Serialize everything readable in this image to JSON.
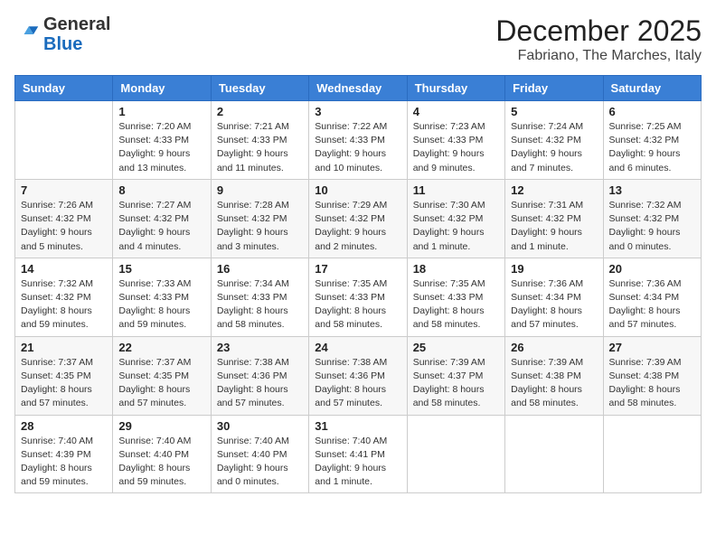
{
  "header": {
    "logo_general": "General",
    "logo_blue": "Blue",
    "month": "December 2025",
    "location": "Fabriano, The Marches, Italy"
  },
  "days_of_week": [
    "Sunday",
    "Monday",
    "Tuesday",
    "Wednesday",
    "Thursday",
    "Friday",
    "Saturday"
  ],
  "weeks": [
    [
      {
        "day": "",
        "sunrise": "",
        "sunset": "",
        "daylight": ""
      },
      {
        "day": "1",
        "sunrise": "Sunrise: 7:20 AM",
        "sunset": "Sunset: 4:33 PM",
        "daylight": "Daylight: 9 hours and 13 minutes."
      },
      {
        "day": "2",
        "sunrise": "Sunrise: 7:21 AM",
        "sunset": "Sunset: 4:33 PM",
        "daylight": "Daylight: 9 hours and 11 minutes."
      },
      {
        "day": "3",
        "sunrise": "Sunrise: 7:22 AM",
        "sunset": "Sunset: 4:33 PM",
        "daylight": "Daylight: 9 hours and 10 minutes."
      },
      {
        "day": "4",
        "sunrise": "Sunrise: 7:23 AM",
        "sunset": "Sunset: 4:33 PM",
        "daylight": "Daylight: 9 hours and 9 minutes."
      },
      {
        "day": "5",
        "sunrise": "Sunrise: 7:24 AM",
        "sunset": "Sunset: 4:32 PM",
        "daylight": "Daylight: 9 hours and 7 minutes."
      },
      {
        "day": "6",
        "sunrise": "Sunrise: 7:25 AM",
        "sunset": "Sunset: 4:32 PM",
        "daylight": "Daylight: 9 hours and 6 minutes."
      }
    ],
    [
      {
        "day": "7",
        "sunrise": "Sunrise: 7:26 AM",
        "sunset": "Sunset: 4:32 PM",
        "daylight": "Daylight: 9 hours and 5 minutes."
      },
      {
        "day": "8",
        "sunrise": "Sunrise: 7:27 AM",
        "sunset": "Sunset: 4:32 PM",
        "daylight": "Daylight: 9 hours and 4 minutes."
      },
      {
        "day": "9",
        "sunrise": "Sunrise: 7:28 AM",
        "sunset": "Sunset: 4:32 PM",
        "daylight": "Daylight: 9 hours and 3 minutes."
      },
      {
        "day": "10",
        "sunrise": "Sunrise: 7:29 AM",
        "sunset": "Sunset: 4:32 PM",
        "daylight": "Daylight: 9 hours and 2 minutes."
      },
      {
        "day": "11",
        "sunrise": "Sunrise: 7:30 AM",
        "sunset": "Sunset: 4:32 PM",
        "daylight": "Daylight: 9 hours and 1 minute."
      },
      {
        "day": "12",
        "sunrise": "Sunrise: 7:31 AM",
        "sunset": "Sunset: 4:32 PM",
        "daylight": "Daylight: 9 hours and 1 minute."
      },
      {
        "day": "13",
        "sunrise": "Sunrise: 7:32 AM",
        "sunset": "Sunset: 4:32 PM",
        "daylight": "Daylight: 9 hours and 0 minutes."
      }
    ],
    [
      {
        "day": "14",
        "sunrise": "Sunrise: 7:32 AM",
        "sunset": "Sunset: 4:32 PM",
        "daylight": "Daylight: 8 hours and 59 minutes."
      },
      {
        "day": "15",
        "sunrise": "Sunrise: 7:33 AM",
        "sunset": "Sunset: 4:33 PM",
        "daylight": "Daylight: 8 hours and 59 minutes."
      },
      {
        "day": "16",
        "sunrise": "Sunrise: 7:34 AM",
        "sunset": "Sunset: 4:33 PM",
        "daylight": "Daylight: 8 hours and 58 minutes."
      },
      {
        "day": "17",
        "sunrise": "Sunrise: 7:35 AM",
        "sunset": "Sunset: 4:33 PM",
        "daylight": "Daylight: 8 hours and 58 minutes."
      },
      {
        "day": "18",
        "sunrise": "Sunrise: 7:35 AM",
        "sunset": "Sunset: 4:33 PM",
        "daylight": "Daylight: 8 hours and 58 minutes."
      },
      {
        "day": "19",
        "sunrise": "Sunrise: 7:36 AM",
        "sunset": "Sunset: 4:34 PM",
        "daylight": "Daylight: 8 hours and 57 minutes."
      },
      {
        "day": "20",
        "sunrise": "Sunrise: 7:36 AM",
        "sunset": "Sunset: 4:34 PM",
        "daylight": "Daylight: 8 hours and 57 minutes."
      }
    ],
    [
      {
        "day": "21",
        "sunrise": "Sunrise: 7:37 AM",
        "sunset": "Sunset: 4:35 PM",
        "daylight": "Daylight: 8 hours and 57 minutes."
      },
      {
        "day": "22",
        "sunrise": "Sunrise: 7:37 AM",
        "sunset": "Sunset: 4:35 PM",
        "daylight": "Daylight: 8 hours and 57 minutes."
      },
      {
        "day": "23",
        "sunrise": "Sunrise: 7:38 AM",
        "sunset": "Sunset: 4:36 PM",
        "daylight": "Daylight: 8 hours and 57 minutes."
      },
      {
        "day": "24",
        "sunrise": "Sunrise: 7:38 AM",
        "sunset": "Sunset: 4:36 PM",
        "daylight": "Daylight: 8 hours and 57 minutes."
      },
      {
        "day": "25",
        "sunrise": "Sunrise: 7:39 AM",
        "sunset": "Sunset: 4:37 PM",
        "daylight": "Daylight: 8 hours and 58 minutes."
      },
      {
        "day": "26",
        "sunrise": "Sunrise: 7:39 AM",
        "sunset": "Sunset: 4:38 PM",
        "daylight": "Daylight: 8 hours and 58 minutes."
      },
      {
        "day": "27",
        "sunrise": "Sunrise: 7:39 AM",
        "sunset": "Sunset: 4:38 PM",
        "daylight": "Daylight: 8 hours and 58 minutes."
      }
    ],
    [
      {
        "day": "28",
        "sunrise": "Sunrise: 7:40 AM",
        "sunset": "Sunset: 4:39 PM",
        "daylight": "Daylight: 8 hours and 59 minutes."
      },
      {
        "day": "29",
        "sunrise": "Sunrise: 7:40 AM",
        "sunset": "Sunset: 4:40 PM",
        "daylight": "Daylight: 8 hours and 59 minutes."
      },
      {
        "day": "30",
        "sunrise": "Sunrise: 7:40 AM",
        "sunset": "Sunset: 4:40 PM",
        "daylight": "Daylight: 9 hours and 0 minutes."
      },
      {
        "day": "31",
        "sunrise": "Sunrise: 7:40 AM",
        "sunset": "Sunset: 4:41 PM",
        "daylight": "Daylight: 9 hours and 1 minute."
      },
      {
        "day": "",
        "sunrise": "",
        "sunset": "",
        "daylight": ""
      },
      {
        "day": "",
        "sunrise": "",
        "sunset": "",
        "daylight": ""
      },
      {
        "day": "",
        "sunrise": "",
        "sunset": "",
        "daylight": ""
      }
    ]
  ]
}
